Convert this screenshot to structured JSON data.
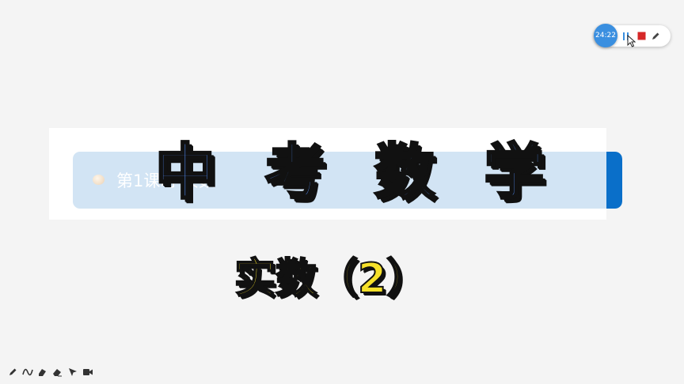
{
  "slide": {
    "banner_text": "第1课时 实数",
    "headline": "中 考 数 学",
    "subtitle": "实数（2）"
  },
  "recorder": {
    "timer": "24:22",
    "buttons": [
      "pause-icon",
      "stop-icon",
      "pen-icon"
    ]
  },
  "toolbar": {
    "tools": [
      "pen-icon",
      "curve-icon",
      "highlighter-icon",
      "eraser-icon",
      "pointer-icon",
      "camera-icon"
    ]
  },
  "colors": {
    "headline_fill": "#4f86ea",
    "subtitle_fill": "#f6e12a",
    "banner_bg": "#d2e4f4",
    "banner_accent": "#0a6fc9",
    "stop_red": "#d62828",
    "timer_blue": "#3a8fe0"
  }
}
